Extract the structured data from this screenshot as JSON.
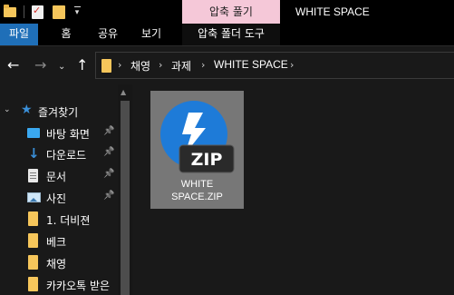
{
  "titlebar": {
    "context_tab": "압축 풀기",
    "window_title": "WHITE SPACE",
    "qat_icons": [
      "folder-icon",
      "properties-icon",
      "new-folder-icon",
      "customize-qat-icon"
    ]
  },
  "ribbon": {
    "tabs": [
      {
        "label": "파일"
      },
      {
        "label": "홈"
      },
      {
        "label": "공유"
      },
      {
        "label": "보기"
      },
      {
        "label": "압축 폴더 도구"
      }
    ],
    "file_tab_color": "#1f6fb8",
    "context_color": "#f5c8d8"
  },
  "nav": {
    "back_icon": "←",
    "forward_icon": "→",
    "recent_icon": "⌄",
    "up_icon": "↑"
  },
  "address": {
    "crumbs": [
      "채영",
      "과제",
      "WHITE SPACE"
    ],
    "separator": "›"
  },
  "sidebar": {
    "quick_access": "즐겨찾기",
    "items": [
      {
        "label": "바탕 화면",
        "icon": "desktop-icon",
        "pinned": true
      },
      {
        "label": "다운로드",
        "icon": "download-icon",
        "pinned": true
      },
      {
        "label": "문서",
        "icon": "document-icon",
        "pinned": true
      },
      {
        "label": "사진",
        "icon": "pictures-icon",
        "pinned": true
      },
      {
        "label": "1. 더비젼",
        "icon": "folder-icon",
        "pinned": false
      },
      {
        "label": "베크",
        "icon": "folder-icon",
        "pinned": false
      },
      {
        "label": "채영",
        "icon": "folder-icon",
        "pinned": false
      },
      {
        "label": "카카오톡 받은",
        "icon": "folder-icon",
        "pinned": false
      }
    ],
    "pin_glyph": "📌"
  },
  "content": {
    "files": [
      {
        "name_line1": "WHITE",
        "name_line2": "SPACE.ZIP",
        "badge": "ZIP",
        "icon": "bandizip-zip-icon"
      }
    ],
    "accent": "#1e7bd8"
  }
}
